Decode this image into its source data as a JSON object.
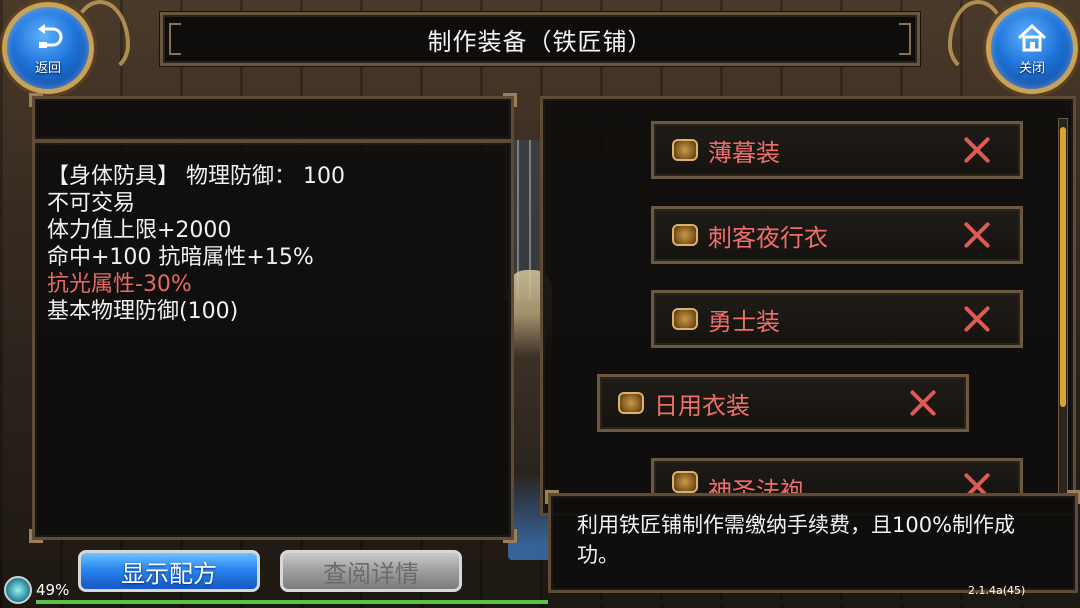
{
  "header": {
    "title": "制作装备（铁匠铺）",
    "back_label": "返回",
    "close_label": "关闭"
  },
  "item_detail": {
    "lines": [
      {
        "text": "【身体防具】 物理防御：  100",
        "color": "#f2f2f2"
      },
      {
        "text": "不可交易",
        "color": "#f2f2f2"
      },
      {
        "text": "体力值上限+2000",
        "color": "#f2f2f2"
      },
      {
        "text": "命中+100 抗暗属性+15%",
        "color": "#f2f2f2"
      },
      {
        "text": "抗光属性-30%",
        "color": "#e36b67"
      },
      {
        "text": "基本物理防御(100)",
        "color": "#f2f2f2"
      }
    ]
  },
  "recipes": [
    {
      "name": "薄暮装"
    },
    {
      "name": "刺客夜行衣"
    },
    {
      "name": "勇士装"
    },
    {
      "name": "日用衣装",
      "selected": true
    },
    {
      "name": "神圣法袍"
    }
  ],
  "info": {
    "text": "利用铁匠铺制作需缴纳手续费，且100%制作成功。"
  },
  "buttons": {
    "show_recipe": "显示配方",
    "view_details": "查阅详情"
  },
  "status": {
    "battery": "49%",
    "progress": 0.49,
    "version": "2.1.4a(45)"
  },
  "colors": {
    "recipe_name": "#ee6f6a",
    "recipe_remove": "#e05a55",
    "primary_button": "#2a86f0",
    "scroll_thumb": "#d8a535"
  }
}
